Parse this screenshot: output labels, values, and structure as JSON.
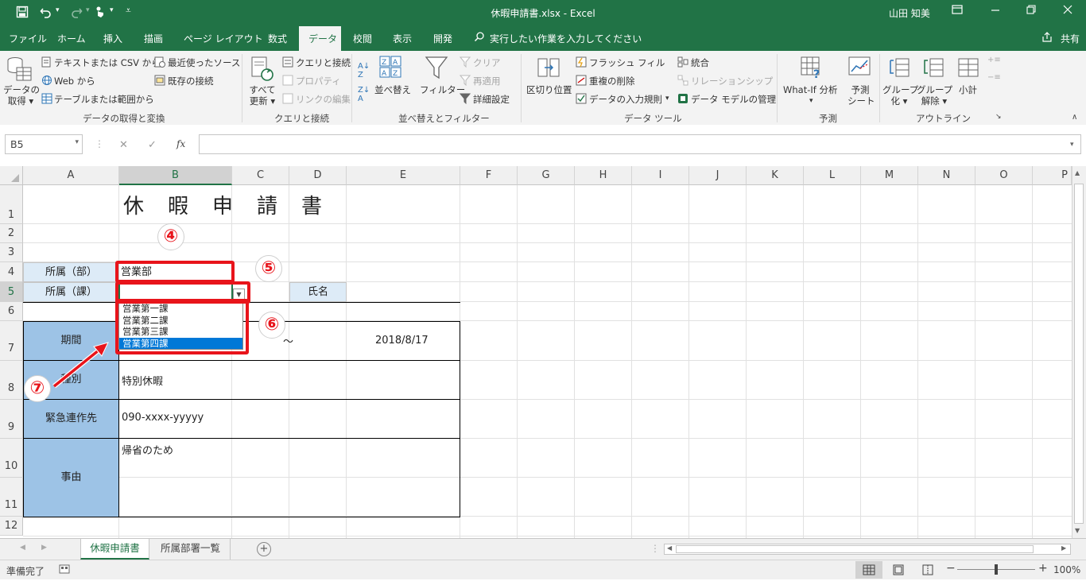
{
  "window": {
    "title": "休暇申請書.xlsx  -  Excel",
    "user": "山田 知美",
    "minimize_icon": "ribbon-display-icon"
  },
  "tabs": [
    "ファイル",
    "ホーム",
    "挿入",
    "描画",
    "ページ レイアウト",
    "数式",
    "データ",
    "校閲",
    "表示",
    "開発"
  ],
  "active_tab": "データ",
  "tell_me": "実行したい作業を入力してください",
  "share": "共有",
  "ribbon": {
    "get_data_label": "データの\n取得",
    "get_data_l1": "データの",
    "get_data_l2": "取得",
    "from_text_csv": "テキストまたは CSV から",
    "from_web": "Web から",
    "from_table": "テーブルまたは範囲から",
    "recent_sources": "最近使ったソース",
    "existing_connections": "既存の接続",
    "group_get_transform": "データの取得と変換",
    "refresh_all_l1": "すべて",
    "refresh_all_l2": "更新",
    "queries_connections": "クエリと接続",
    "properties": "プロパティ",
    "edit_links": "リンクの編集",
    "group_queries": "クエリと接続",
    "sort_label": "並べ替え",
    "filter_label": "フィルター",
    "clear": "クリア",
    "reapply": "再適用",
    "advanced": "詳細設定",
    "group_sort_filter": "並べ替えとフィルター",
    "text_to_columns": "区切り位置",
    "flash_fill": "フラッシュ フィル",
    "remove_duplicates": "重複の削除",
    "data_validation": "データの入力規則",
    "consolidate": "統合",
    "relationships": "リレーションシップ",
    "data_model": "データ モデルの管理",
    "group_data_tools": "データ ツール",
    "what_if": "What-If 分析",
    "forecast_l1": "予測",
    "forecast_l2": "シート",
    "group_forecast": "予測",
    "group_l1": "グループ",
    "group_l2": "化",
    "ungroup_l1": "グループ",
    "ungroup_l2": "解除",
    "subtotal": "小計",
    "group_outline": "アウトライン"
  },
  "formula_bar": {
    "name_box": "B5",
    "cancel_icon": "✕",
    "enter_icon": "✓",
    "fx": "fx",
    "value": ""
  },
  "columns": [
    "A",
    "B",
    "C",
    "D",
    "E",
    "F",
    "G",
    "H",
    "I",
    "J",
    "K",
    "L",
    "M",
    "N",
    "O",
    "P"
  ],
  "rows": [
    "1",
    "2",
    "3",
    "4",
    "5",
    "6",
    "7",
    "8",
    "9",
    "10",
    "11",
    "12"
  ],
  "sheet": {
    "title": "休　暇　申　請　書",
    "dept_label": "所属（部）",
    "dept_value": "営業部",
    "section_label": "所属（課）",
    "section_value": "",
    "name_label": "氏名",
    "period_label": "期間",
    "period_sep": "～",
    "period_end": "2018/8/17",
    "type_label": "種別",
    "type_value": "特別休暇",
    "contact_label": "緊急連作先",
    "contact_value": "090-xxxx-yyyyy",
    "reason_label": "事由",
    "reason_value": "帰省のため"
  },
  "dropdown": {
    "options": [
      "営業第一課",
      "営業第二課",
      "営業第三課",
      "営業第四課"
    ],
    "highlighted": "営業第四課"
  },
  "callouts": [
    "④",
    "⑤",
    "⑥",
    "⑦"
  ],
  "sheet_tabs": [
    "休暇申請書",
    "所属部署一覧"
  ],
  "active_sheet": "休暇申請書",
  "status": {
    "ready": "準備完了",
    "zoom": "100%"
  },
  "colors": {
    "excel_green": "#217346",
    "label_blue": "#9dc3e6",
    "highlight_red": "#e8141b",
    "selection_blue": "#0078d7"
  }
}
